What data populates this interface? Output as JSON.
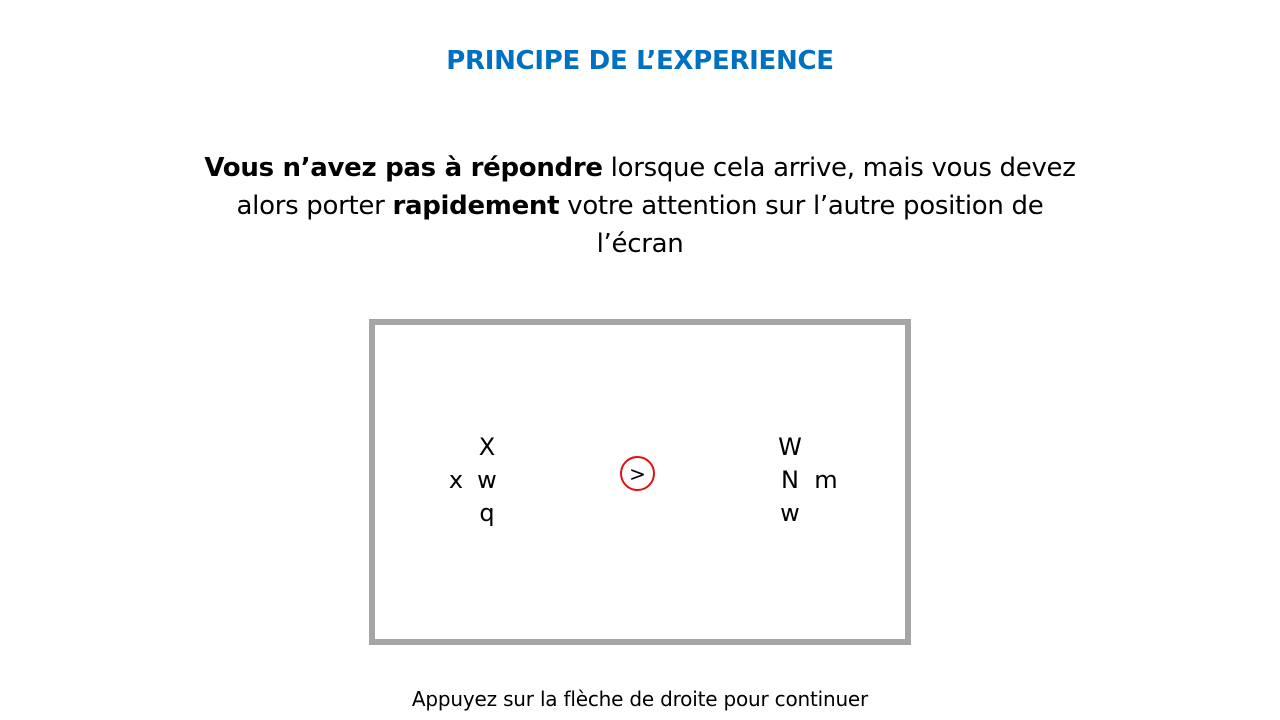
{
  "slide": {
    "title": "PRINCIPE DE L’EXPERIENCE",
    "instruction": {
      "part1_bold": "Vous n’avez pas à répondre",
      "part2": " lorsque cela arrive, mais vous devez alors porter ",
      "part3_bold": "rapidement",
      "part4": " votre attention sur l’autre position de l’écran"
    },
    "stimulus": {
      "left_cluster": {
        "top": "X",
        "left": "x",
        "center": "w",
        "bottom": "q"
      },
      "fixation": {
        "symbol": ">"
      },
      "right_cluster": {
        "top": "W",
        "center": "N",
        "right": "m",
        "bottom": "w"
      }
    },
    "footer": "Appuyez sur la flèche de droite pour continuer"
  },
  "colors": {
    "title": "#0070c0",
    "frame_border": "#a5a5a5",
    "fixation_circle": "#e01010",
    "text": "#000000",
    "background": "#ffffff"
  }
}
